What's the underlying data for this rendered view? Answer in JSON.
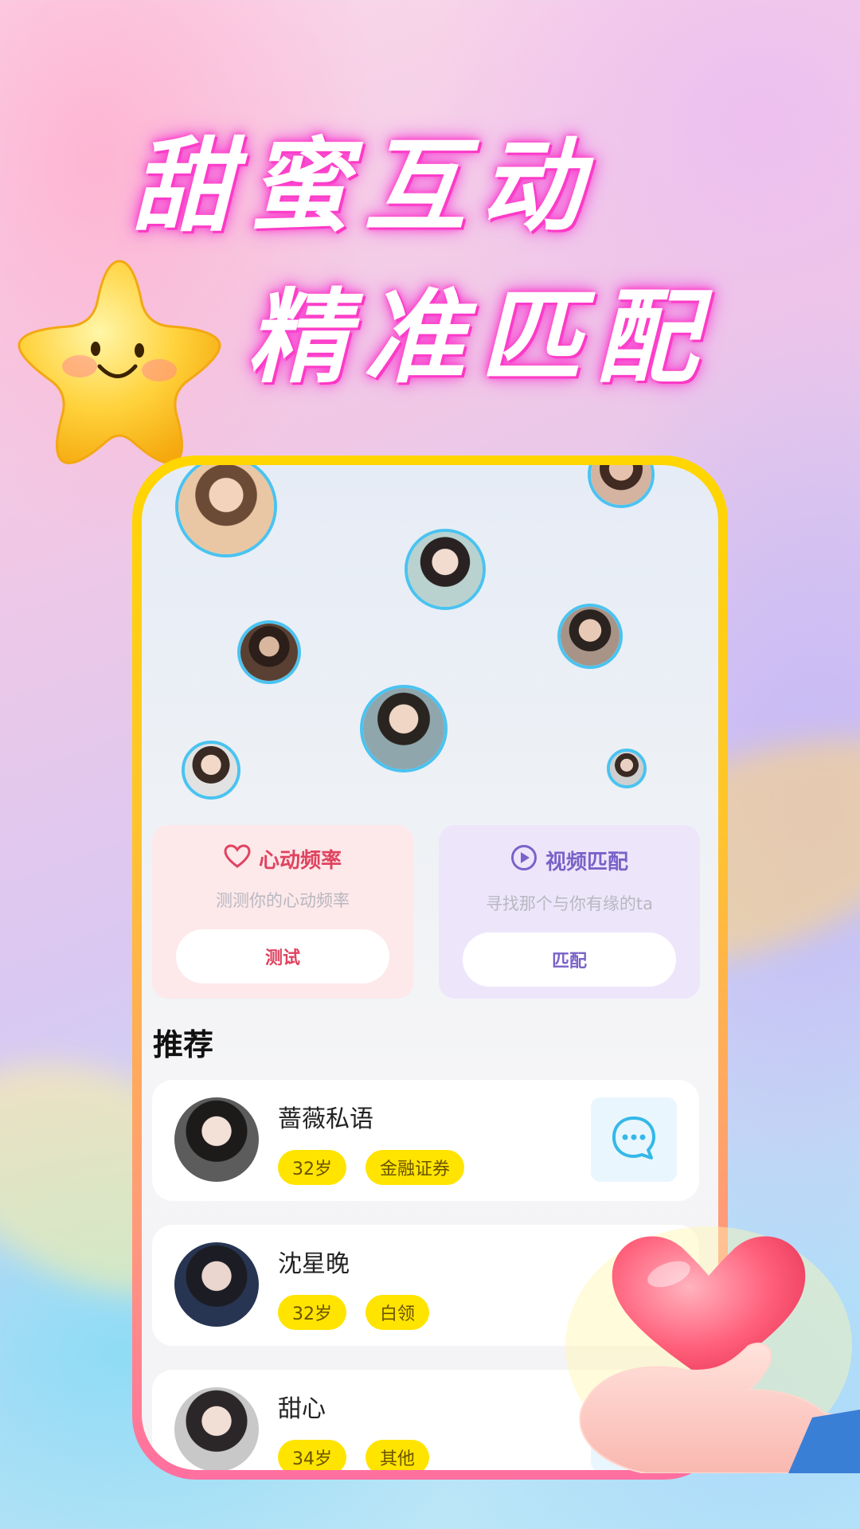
{
  "headline": {
    "line1": "甜蜜互动",
    "line2": "精准匹配"
  },
  "cards": {
    "heart": {
      "icon": "heart-outline-icon",
      "title": "心动频率",
      "subtitle": "测测你的心动频率",
      "button": "测试"
    },
    "video": {
      "icon": "play-circle-icon",
      "title": "视频匹配",
      "subtitle": "寻找那个与你有缘的ta",
      "button": "匹配"
    }
  },
  "recommend": {
    "title": "推荐",
    "items": [
      {
        "name": "蔷薇私语",
        "tags": [
          "32岁",
          "金融证券"
        ]
      },
      {
        "name": "沈星晚",
        "tags": [
          "32岁",
          "白领"
        ]
      },
      {
        "name": "甜心",
        "tags": [
          "34岁",
          "其他"
        ]
      }
    ]
  },
  "colors": {
    "frame_top": "#ffd600",
    "frame_bottom": "#ff6fa0",
    "bubble_border": "#4ac3f0",
    "tag_bg": "#ffe400",
    "heart_accent": "#e0435f",
    "video_accent": "#7a62c8"
  }
}
